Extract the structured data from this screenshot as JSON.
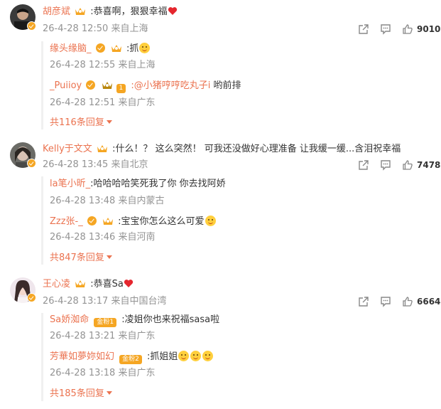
{
  "comments": [
    {
      "user": "胡彦斌",
      "text": ":恭喜啊，狠狠幸福",
      "time": "26-4-28 12:50",
      "location": "来自上海",
      "likes": "9010",
      "replies": [
        {
          "user": "缘头缘脑_",
          "text": ":抓",
          "time": "26-4-28 12:55",
          "location": "来自上海"
        },
        {
          "user": "_Puiioy",
          "level": "1",
          "mention": ":@小猪哼哼吃丸子i",
          "text": " 哟前排",
          "time": "26-4-28 12:51",
          "location": "来自广东"
        }
      ],
      "more": "共116条回复"
    },
    {
      "user": "Kelly于文文",
      "text": ":什么！？ 这么突然！ 可我还没做好心理准备 让我缓一缓...含泪祝幸福",
      "time": "26-4-28 13:45",
      "location": "来自北京",
      "likes": "7478",
      "replies": [
        {
          "user": "la笔小昕_",
          "text": ":哈哈哈哈笑死我了你 你去找阿娇",
          "time": "26-4-28 13:48",
          "location": "来自内蒙古"
        },
        {
          "user": "Zzz张-_",
          "text": ":宝宝你怎么这么可爱",
          "time": "26-4-28 13:46",
          "location": "来自河南"
        }
      ],
      "more": "共847条回复"
    },
    {
      "user": "王心凌",
      "text": ":恭喜Sa",
      "time": "26-4-28 13:17",
      "location": "来自中国台湾",
      "likes": "6664",
      "replies": [
        {
          "user": "Sa娇洳命",
          "fan_badge": "金粉1",
          "text": ":凌姐你也来祝福sasa啦",
          "time": "26-4-28 13:21",
          "location": "来自广东"
        },
        {
          "user": "芳華如夢妳如幻",
          "fan_badge": "金粉2",
          "text": ":抓姐姐",
          "time": "26-4-28 13:18",
          "location": "来自广东"
        }
      ],
      "more": "共185条回复"
    }
  ],
  "colors": {
    "username": "#eb7350",
    "meta": "#939393",
    "badge": "#f5a623"
  },
  "icons": [
    "share-icon",
    "comment-icon",
    "like-icon",
    "crown-icon",
    "verified-badge-icon",
    "heart-icon",
    "emoji-icon"
  ]
}
